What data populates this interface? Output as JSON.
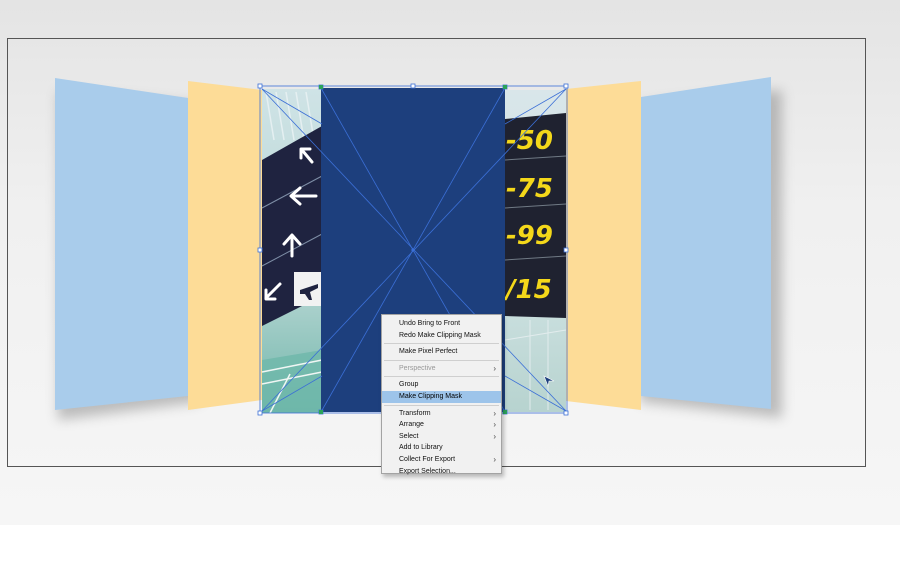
{
  "canvas": {
    "colors": {
      "panel_blue": "#a9cceb",
      "panel_yellow": "#fddc97",
      "navy_rect": "#1d3f7d",
      "selection": "#3b6fd6",
      "sign_yellow": "#f4d81a"
    },
    "sign_numbers": [
      "-50",
      "-75",
      "-99",
      "/15"
    ],
    "sign_icons": [
      "arrow-up-left-icon",
      "arrow-left-icon",
      "arrow-up-icon",
      "plane-icon"
    ]
  },
  "context_menu": {
    "items": [
      {
        "label": "Undo Bring to Front"
      },
      {
        "label": "Redo Make Clipping Mask"
      },
      {
        "separator": true
      },
      {
        "label": "Make Pixel Perfect"
      },
      {
        "separator": true
      },
      {
        "label": "Perspective",
        "disabled": true,
        "submenu": true
      },
      {
        "separator": true
      },
      {
        "label": "Group"
      },
      {
        "label": "Make Clipping Mask",
        "highlighted": true
      },
      {
        "separator": true
      },
      {
        "label": "Transform",
        "submenu": true
      },
      {
        "label": "Arrange",
        "submenu": true
      },
      {
        "label": "Select",
        "submenu": true
      },
      {
        "label": "Add to Library"
      },
      {
        "label": "Collect For Export",
        "submenu": true
      },
      {
        "label": "Export Selection..."
      }
    ],
    "submenu_arrow": "›"
  }
}
